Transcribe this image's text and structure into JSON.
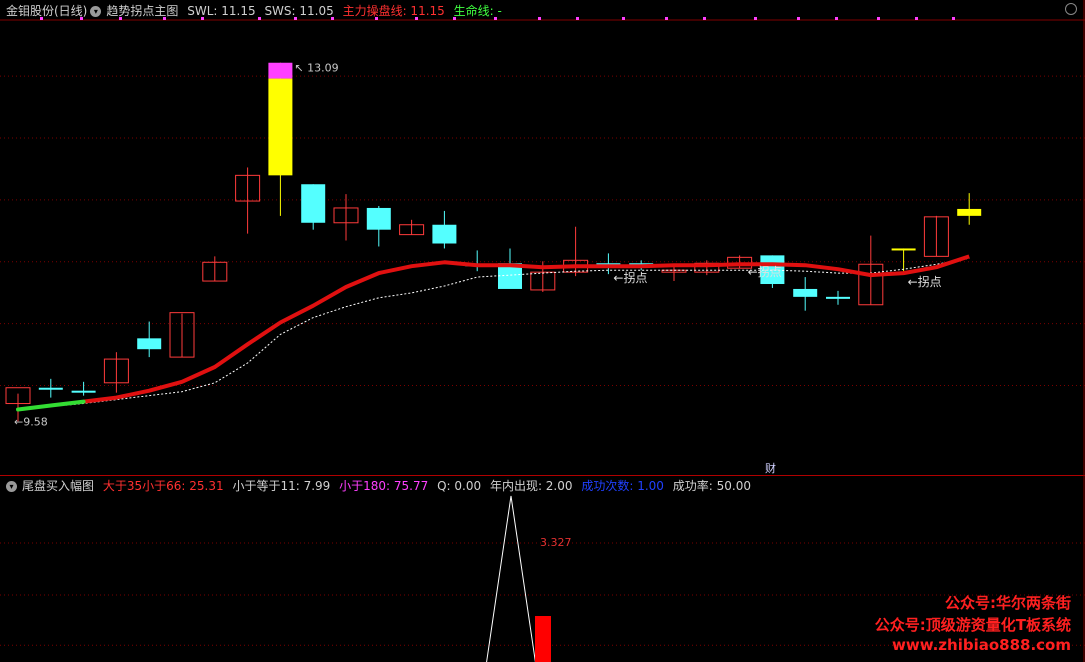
{
  "main_header": {
    "stock_title": "金钼股份(日线)",
    "indicator_name": "趋势拐点主图",
    "swl": "SWL: 11.15",
    "sws": "SWS: 11.05",
    "main_line": "主力操盘线: 11.15",
    "life_line": "生命线: -"
  },
  "sub_header": {
    "indicator_name": "尾盘买入幅图",
    "f1": "大于35小于66: 25.31",
    "f2": "小于等于11: 7.99",
    "f3": "小于180: 75.77",
    "f4": "Q: 0.00",
    "f5": "年内出现: 2.00",
    "f6": "成功次数: 1.00",
    "f7": "成功率: 50.00"
  },
  "colors": {
    "up_candle": "#ff3b3b",
    "down_candle": "#54ffff",
    "highlight_candle": "#ffff00",
    "peak_marker": "#ff40ff",
    "main_line": "#e01010",
    "main_line_start": "#33dd33",
    "life_line": "#ffffff",
    "grid": "#7a0000",
    "watermark": "#ff2020"
  },
  "annotations": {
    "high_label": "13.09",
    "low_label": "←9.58",
    "turn_points": [
      "←拐点",
      "←拐点",
      "←拐点"
    ],
    "finance_marker": "财",
    "sub_value_label": "3.327"
  },
  "watermark": {
    "line1": "公众号:华尔两条街",
    "line2": "公众号:顶级游资量化T板系统",
    "line3": "www.zhibiao888.com"
  },
  "chart_data": [
    {
      "type": "candlestick",
      "ylim": [
        9.2,
        13.3
      ],
      "candles": [
        {
          "o": 9.64,
          "h": 9.74,
          "l": 9.46,
          "c": 9.8,
          "color": "up"
        },
        {
          "o": 9.8,
          "h": 9.89,
          "l": 9.7,
          "c": 9.8,
          "color": "down"
        },
        {
          "o": 9.77,
          "h": 9.86,
          "l": 9.72,
          "c": 9.77,
          "color": "down"
        },
        {
          "o": 9.85,
          "h": 10.16,
          "l": 9.75,
          "c": 10.09,
          "color": "up"
        },
        {
          "o": 10.3,
          "h": 10.47,
          "l": 10.11,
          "c": 10.19,
          "color": "down"
        },
        {
          "o": 10.11,
          "h": 10.55,
          "l": 10.11,
          "c": 10.56,
          "color": "up"
        },
        {
          "o": 10.88,
          "h": 11.13,
          "l": 10.88,
          "c": 11.07,
          "color": "up"
        },
        {
          "o": 11.69,
          "h": 12.03,
          "l": 11.36,
          "c": 11.95,
          "color": "up"
        },
        {
          "o": 12.93,
          "h": 13.09,
          "l": 11.54,
          "c": 11.95,
          "color": "highlight"
        },
        {
          "o": 11.86,
          "h": 11.86,
          "l": 11.4,
          "c": 11.47,
          "color": "down"
        },
        {
          "o": 11.47,
          "h": 11.76,
          "l": 11.29,
          "c": 11.62,
          "color": "up"
        },
        {
          "o": 11.62,
          "h": 11.64,
          "l": 11.23,
          "c": 11.4,
          "color": "down"
        },
        {
          "o": 11.35,
          "h": 11.5,
          "l": 11.35,
          "c": 11.45,
          "color": "up"
        },
        {
          "o": 11.45,
          "h": 11.59,
          "l": 11.21,
          "c": 11.26,
          "color": "down"
        },
        {
          "o": 11.05,
          "h": 11.19,
          "l": 10.98,
          "c": 11.05,
          "color": "down"
        },
        {
          "o": 11.06,
          "h": 11.21,
          "l": 10.81,
          "c": 10.8,
          "color": "down"
        },
        {
          "o": 10.79,
          "h": 11.08,
          "l": 10.77,
          "c": 10.97,
          "color": "up"
        },
        {
          "o": 10.97,
          "h": 11.43,
          "l": 10.93,
          "c": 11.09,
          "color": "up"
        },
        {
          "o": 11.06,
          "h": 11.16,
          "l": 10.95,
          "c": 11.06,
          "color": "down"
        },
        {
          "o": 11.06,
          "h": 11.09,
          "l": 10.99,
          "c": 11.06,
          "color": "down"
        },
        {
          "o": 10.99,
          "h": 11.04,
          "l": 10.88,
          "c": 10.99,
          "color": "up"
        },
        {
          "o": 10.97,
          "h": 11.09,
          "l": 10.94,
          "c": 11.06,
          "color": "up"
        },
        {
          "o": 11.01,
          "h": 11.14,
          "l": 11.01,
          "c": 11.12,
          "color": "up"
        },
        {
          "o": 11.14,
          "h": 11.14,
          "l": 10.81,
          "c": 10.85,
          "color": "down"
        },
        {
          "o": 10.8,
          "h": 10.92,
          "l": 10.58,
          "c": 10.72,
          "color": "down"
        },
        {
          "o": 10.72,
          "h": 10.78,
          "l": 10.64,
          "c": 10.7,
          "color": "down"
        },
        {
          "o": 10.64,
          "h": 11.34,
          "l": 10.64,
          "c": 11.05,
          "color": "up"
        },
        {
          "o": 11.21,
          "h": 11.21,
          "l": 10.98,
          "c": 11.2,
          "color": "highlight"
        },
        {
          "o": 11.13,
          "h": 11.54,
          "l": 11.13,
          "c": 11.53,
          "color": "up"
        },
        {
          "o": 11.61,
          "h": 11.77,
          "l": 11.45,
          "c": 11.54,
          "color": "highlight"
        }
      ],
      "main_line": [
        9.58,
        9.62,
        9.66,
        9.7,
        9.77,
        9.86,
        10.01,
        10.24,
        10.46,
        10.63,
        10.82,
        10.96,
        11.03,
        11.07,
        11.04,
        11.04,
        11.02,
        11.03,
        11.03,
        11.03,
        11.04,
        11.04,
        11.05,
        11.05,
        11.04,
        11.0,
        10.94,
        10.96,
        11.02,
        11.13
      ],
      "life_line": [
        9.58,
        9.61,
        9.64,
        9.68,
        9.72,
        9.76,
        9.85,
        10.05,
        10.34,
        10.51,
        10.62,
        10.71,
        10.76,
        10.83,
        10.92,
        10.94,
        10.96,
        10.98,
        10.99,
        10.99,
        10.99,
        10.99,
        10.99,
        10.99,
        10.98,
        10.96,
        10.96,
        11.0,
        11.05,
        11.11
      ]
    },
    {
      "type": "line",
      "x": [
        0,
        1,
        2
      ],
      "values": [
        0,
        3.327,
        0
      ],
      "bar_value": 3.327
    }
  ]
}
